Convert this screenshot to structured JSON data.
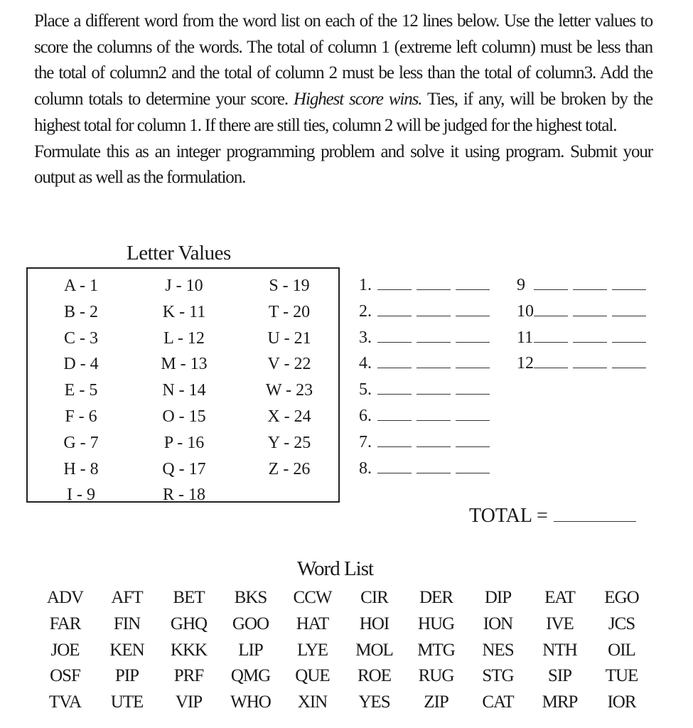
{
  "instructions": {
    "para1_start": "Place a different word from the word list on each of the 12 lines below. Use the letter values to score the columns of the words.   The total of column 1 (extreme left column) must be less than the total of column2 and the total of column 2 must be less than the total of column3. Add the column totals to determine your score.   ",
    "para1_emphasis": "Highest score wins.",
    "para1_end": " Ties, if any, will be broken by the highest total for column 1.   If there are still ties, column 2 will be judged for the highest total.",
    "para2": "Formulate this as an integer programming problem and solve it using program.   Submit your output as well as the formulation."
  },
  "letter_values": {
    "title": "Letter Values",
    "columns": [
      [
        "A - 1",
        "B - 2",
        "C - 3",
        "D - 4",
        "E - 5",
        "F - 6",
        "G - 7",
        "H - 8",
        "I - 9"
      ],
      [
        "J - 10",
        "K - 11",
        "L - 12",
        "M - 13",
        "N - 14",
        "O - 15",
        "P - 16",
        "Q - 17",
        "R - 18"
      ],
      [
        "S - 19",
        "T - 20",
        "U - 21",
        "V - 22",
        "W - 23",
        "X - 24",
        "Y - 25",
        "Z - 26"
      ]
    ]
  },
  "answer_lines": {
    "left": [
      "1.",
      "2.",
      "3.",
      "4.",
      "5.",
      "6.",
      "7.",
      "8."
    ],
    "right": [
      "9",
      "10",
      "11",
      "12"
    ]
  },
  "total": {
    "label": "TOTAL ="
  },
  "word_list": {
    "title": "Word List",
    "rows": [
      [
        "ADV",
        "AFT",
        "BET",
        "BKS",
        "CCW",
        "CIR",
        "DER",
        "DIP",
        "EAT",
        "EGO"
      ],
      [
        "FAR",
        "FIN",
        "GHQ",
        "GOO",
        "HAT",
        "HOI",
        "HUG",
        "ION",
        "IVE",
        "JCS"
      ],
      [
        "JOE",
        "KEN",
        "KKK",
        "LIP",
        "LYE",
        "MOL",
        "MTG",
        "NES",
        "NTH",
        "OIL"
      ],
      [
        "OSF",
        "PIP",
        "PRF",
        "QMG",
        "QUE",
        "ROE",
        "RUG",
        "STG",
        "SIP",
        "TUE"
      ],
      [
        "TVA",
        "UTE",
        "VIP",
        "WHO",
        "XIN",
        "YES",
        "ZIP",
        "CAT",
        "MRP",
        "IOR"
      ]
    ]
  }
}
